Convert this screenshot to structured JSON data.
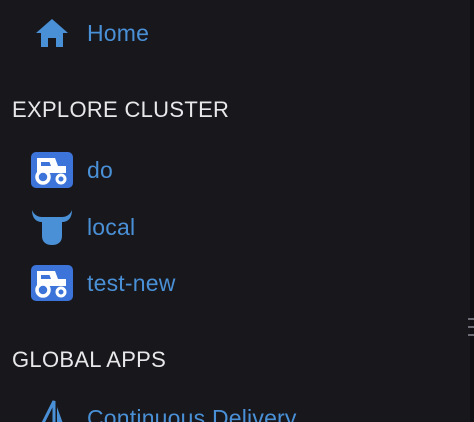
{
  "nav": {
    "home": {
      "label": "Home",
      "icon": "home-icon"
    }
  },
  "explore_cluster": {
    "title": "EXPLORE CLUSTER",
    "clusters": [
      {
        "label": "do",
        "icon": "cattle-tractor-icon"
      },
      {
        "label": "local",
        "icon": "k3s-bull-icon"
      },
      {
        "label": "test-new",
        "icon": "cattle-tractor-icon"
      }
    ]
  },
  "global_apps": {
    "title": "GLOBAL APPS",
    "items": [
      {
        "label": "Continuous Delivery",
        "icon": "sailboat-icon"
      }
    ]
  },
  "colors": {
    "background": "#18171c",
    "link": "#4a90d6",
    "section_title": "#e8e8ea",
    "icon_badge": "#3d74d9"
  }
}
